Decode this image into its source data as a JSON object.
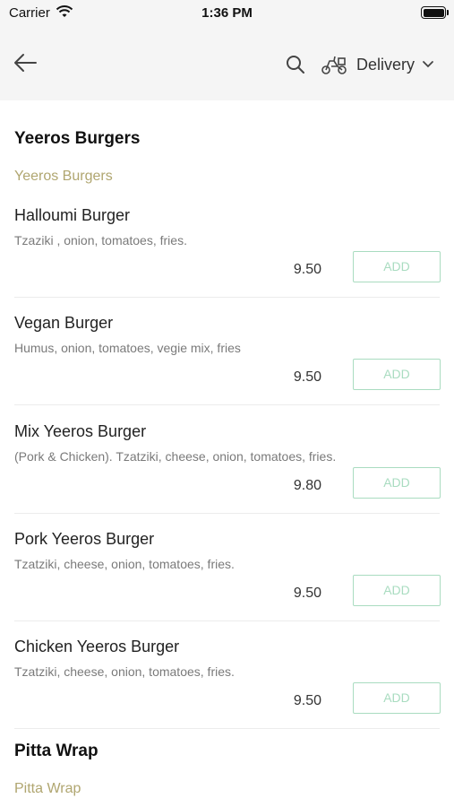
{
  "status_bar": {
    "carrier": "Carrier",
    "time": "1:36 PM"
  },
  "nav": {
    "back_icon": "arrow-left-icon",
    "search_icon": "search-icon",
    "delivery_icon": "scooter-icon",
    "delivery_label": "Delivery",
    "dropdown_icon": "chevron-down-icon"
  },
  "sections": [
    {
      "title": "Yeeros Burgers",
      "subtitle": "Yeeros Burgers",
      "items": [
        {
          "name": "Halloumi Burger",
          "description": "Tzaziki , onion, tomatoes, fries.",
          "price": "9.50",
          "add_label": "ADD"
        },
        {
          "name": "Vegan Burger",
          "description": "Humus, onion, tomatoes, vegie mix, fries",
          "price": "9.50",
          "add_label": "ADD"
        },
        {
          "name": "Mix Yeeros Burger",
          "description": "(Pork & Chicken). Tzatziki, cheese, onion, tomatoes, fries.",
          "price": "9.80",
          "add_label": "ADD"
        },
        {
          "name": "Pork Yeeros Burger",
          "description": "Tzatziki, cheese, onion, tomatoes, fries.",
          "price": "9.50",
          "add_label": "ADD"
        },
        {
          "name": "Chicken Yeeros Burger",
          "description": "Tzatziki, cheese, onion, tomatoes, fries.",
          "price": "9.50",
          "add_label": "ADD"
        }
      ]
    },
    {
      "title": "Pitta Wrap",
      "subtitle": "Pitta Wrap",
      "items": []
    }
  ],
  "colors": {
    "header_bg": "#f5f5f5",
    "accent_green": "#a9dcc0",
    "subtitle_gold": "#b0a670"
  }
}
